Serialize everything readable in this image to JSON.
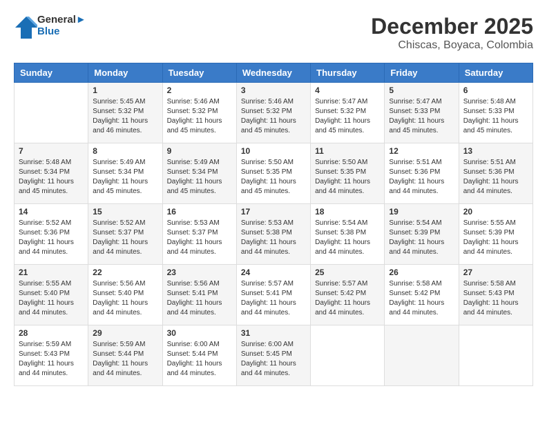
{
  "header": {
    "logo_line1": "General",
    "logo_line2": "Blue",
    "month_title": "December 2025",
    "subtitle": "Chiscas, Boyaca, Colombia"
  },
  "weekdays": [
    "Sunday",
    "Monday",
    "Tuesday",
    "Wednesday",
    "Thursday",
    "Friday",
    "Saturday"
  ],
  "weeks": [
    [
      {
        "day": "",
        "sunrise": "",
        "sunset": "",
        "daylight": ""
      },
      {
        "day": "1",
        "sunrise": "5:45 AM",
        "sunset": "5:32 PM",
        "daylight": "11 hours and 46 minutes."
      },
      {
        "day": "2",
        "sunrise": "5:46 AM",
        "sunset": "5:32 PM",
        "daylight": "11 hours and 45 minutes."
      },
      {
        "day": "3",
        "sunrise": "5:46 AM",
        "sunset": "5:32 PM",
        "daylight": "11 hours and 45 minutes."
      },
      {
        "day": "4",
        "sunrise": "5:47 AM",
        "sunset": "5:32 PM",
        "daylight": "11 hours and 45 minutes."
      },
      {
        "day": "5",
        "sunrise": "5:47 AM",
        "sunset": "5:33 PM",
        "daylight": "11 hours and 45 minutes."
      },
      {
        "day": "6",
        "sunrise": "5:48 AM",
        "sunset": "5:33 PM",
        "daylight": "11 hours and 45 minutes."
      }
    ],
    [
      {
        "day": "7",
        "sunrise": "5:48 AM",
        "sunset": "5:34 PM",
        "daylight": "11 hours and 45 minutes."
      },
      {
        "day": "8",
        "sunrise": "5:49 AM",
        "sunset": "5:34 PM",
        "daylight": "11 hours and 45 minutes."
      },
      {
        "day": "9",
        "sunrise": "5:49 AM",
        "sunset": "5:34 PM",
        "daylight": "11 hours and 45 minutes."
      },
      {
        "day": "10",
        "sunrise": "5:50 AM",
        "sunset": "5:35 PM",
        "daylight": "11 hours and 45 minutes."
      },
      {
        "day": "11",
        "sunrise": "5:50 AM",
        "sunset": "5:35 PM",
        "daylight": "11 hours and 44 minutes."
      },
      {
        "day": "12",
        "sunrise": "5:51 AM",
        "sunset": "5:36 PM",
        "daylight": "11 hours and 44 minutes."
      },
      {
        "day": "13",
        "sunrise": "5:51 AM",
        "sunset": "5:36 PM",
        "daylight": "11 hours and 44 minutes."
      }
    ],
    [
      {
        "day": "14",
        "sunrise": "5:52 AM",
        "sunset": "5:36 PM",
        "daylight": "11 hours and 44 minutes."
      },
      {
        "day": "15",
        "sunrise": "5:52 AM",
        "sunset": "5:37 PM",
        "daylight": "11 hours and 44 minutes."
      },
      {
        "day": "16",
        "sunrise": "5:53 AM",
        "sunset": "5:37 PM",
        "daylight": "11 hours and 44 minutes."
      },
      {
        "day": "17",
        "sunrise": "5:53 AM",
        "sunset": "5:38 PM",
        "daylight": "11 hours and 44 minutes."
      },
      {
        "day": "18",
        "sunrise": "5:54 AM",
        "sunset": "5:38 PM",
        "daylight": "11 hours and 44 minutes."
      },
      {
        "day": "19",
        "sunrise": "5:54 AM",
        "sunset": "5:39 PM",
        "daylight": "11 hours and 44 minutes."
      },
      {
        "day": "20",
        "sunrise": "5:55 AM",
        "sunset": "5:39 PM",
        "daylight": "11 hours and 44 minutes."
      }
    ],
    [
      {
        "day": "21",
        "sunrise": "5:55 AM",
        "sunset": "5:40 PM",
        "daylight": "11 hours and 44 minutes."
      },
      {
        "day": "22",
        "sunrise": "5:56 AM",
        "sunset": "5:40 PM",
        "daylight": "11 hours and 44 minutes."
      },
      {
        "day": "23",
        "sunrise": "5:56 AM",
        "sunset": "5:41 PM",
        "daylight": "11 hours and 44 minutes."
      },
      {
        "day": "24",
        "sunrise": "5:57 AM",
        "sunset": "5:41 PM",
        "daylight": "11 hours and 44 minutes."
      },
      {
        "day": "25",
        "sunrise": "5:57 AM",
        "sunset": "5:42 PM",
        "daylight": "11 hours and 44 minutes."
      },
      {
        "day": "26",
        "sunrise": "5:58 AM",
        "sunset": "5:42 PM",
        "daylight": "11 hours and 44 minutes."
      },
      {
        "day": "27",
        "sunrise": "5:58 AM",
        "sunset": "5:43 PM",
        "daylight": "11 hours and 44 minutes."
      }
    ],
    [
      {
        "day": "28",
        "sunrise": "5:59 AM",
        "sunset": "5:43 PM",
        "daylight": "11 hours and 44 minutes."
      },
      {
        "day": "29",
        "sunrise": "5:59 AM",
        "sunset": "5:44 PM",
        "daylight": "11 hours and 44 minutes."
      },
      {
        "day": "30",
        "sunrise": "6:00 AM",
        "sunset": "5:44 PM",
        "daylight": "11 hours and 44 minutes."
      },
      {
        "day": "31",
        "sunrise": "6:00 AM",
        "sunset": "5:45 PM",
        "daylight": "11 hours and 44 minutes."
      },
      {
        "day": "",
        "sunrise": "",
        "sunset": "",
        "daylight": ""
      },
      {
        "day": "",
        "sunrise": "",
        "sunset": "",
        "daylight": ""
      },
      {
        "day": "",
        "sunrise": "",
        "sunset": "",
        "daylight": ""
      }
    ]
  ]
}
